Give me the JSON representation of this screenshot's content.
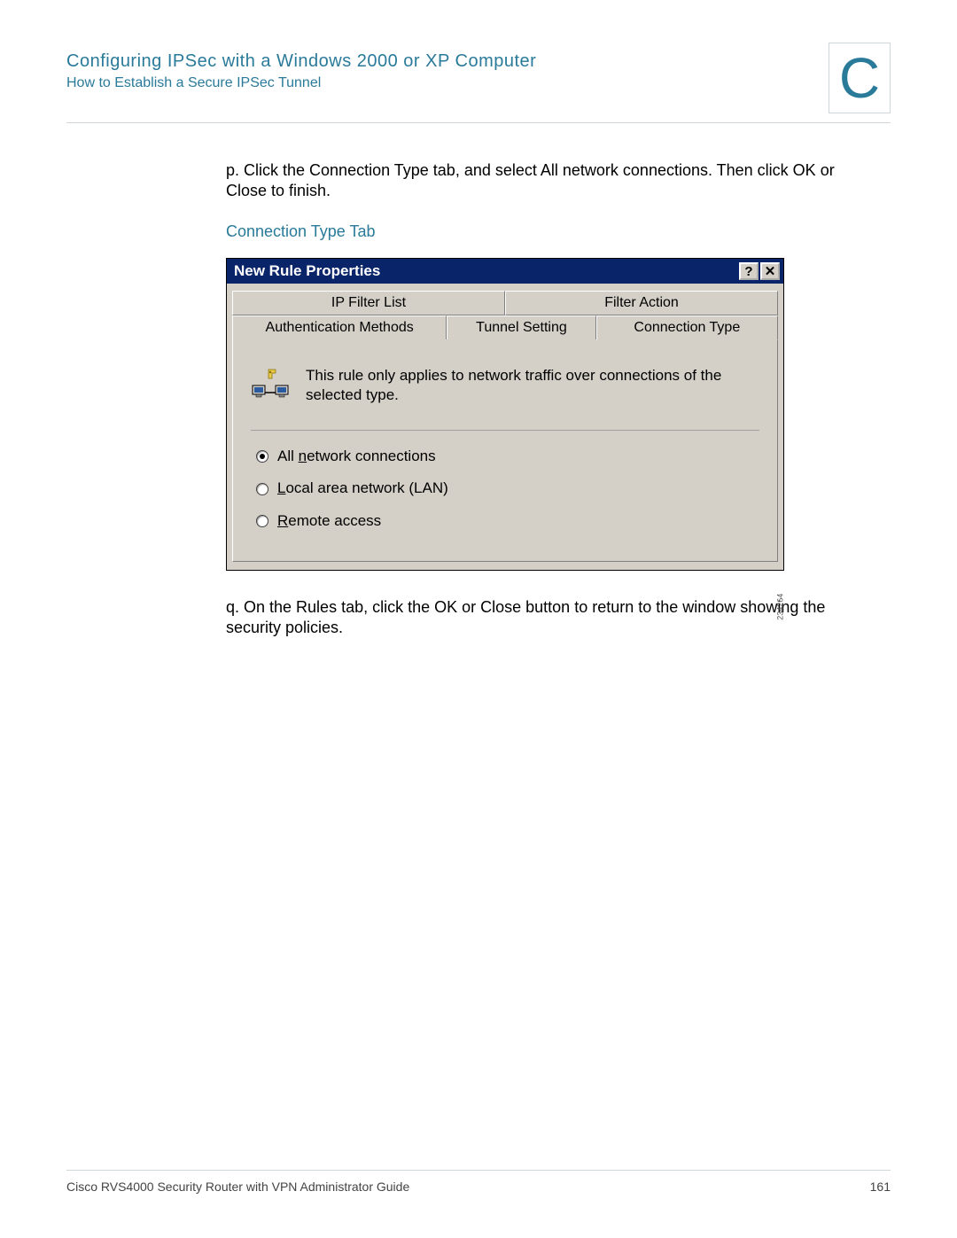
{
  "header": {
    "chapter": "Configuring IPSec with a Windows 2000 or XP Computer",
    "section": "How to Establish a Secure IPSec Tunnel",
    "appendix_letter": "C"
  },
  "content": {
    "step_p": "p.  Click the Connection Type tab, and select All network connections. Then click OK or Close to finish.",
    "caption": "Connection Type Tab",
    "step_q": "q.  On the Rules tab, click the OK or Close button to return to the window showing the security policies."
  },
  "dialog": {
    "title": "New Rule Properties",
    "help_btn": "?",
    "close_btn": "✕",
    "tabs": {
      "ip_filter_list": "IP Filter List",
      "filter_action": "Filter Action",
      "auth_methods": "Authentication Methods",
      "tunnel_setting": "Tunnel Setting",
      "connection_type": "Connection Type"
    },
    "info_text": "This rule only applies to network traffic over connections of the selected type.",
    "radios": {
      "all_pre": "All ",
      "all_u": "n",
      "all_post": "etwork connections",
      "lan_u": "L",
      "lan_post": "ocal area network (LAN)",
      "remote_u": "R",
      "remote_post": "emote access"
    },
    "image_id": "234264"
  },
  "footer": {
    "guide": "Cisco RVS4000 Security Router with VPN Administrator Guide",
    "page": "161"
  }
}
